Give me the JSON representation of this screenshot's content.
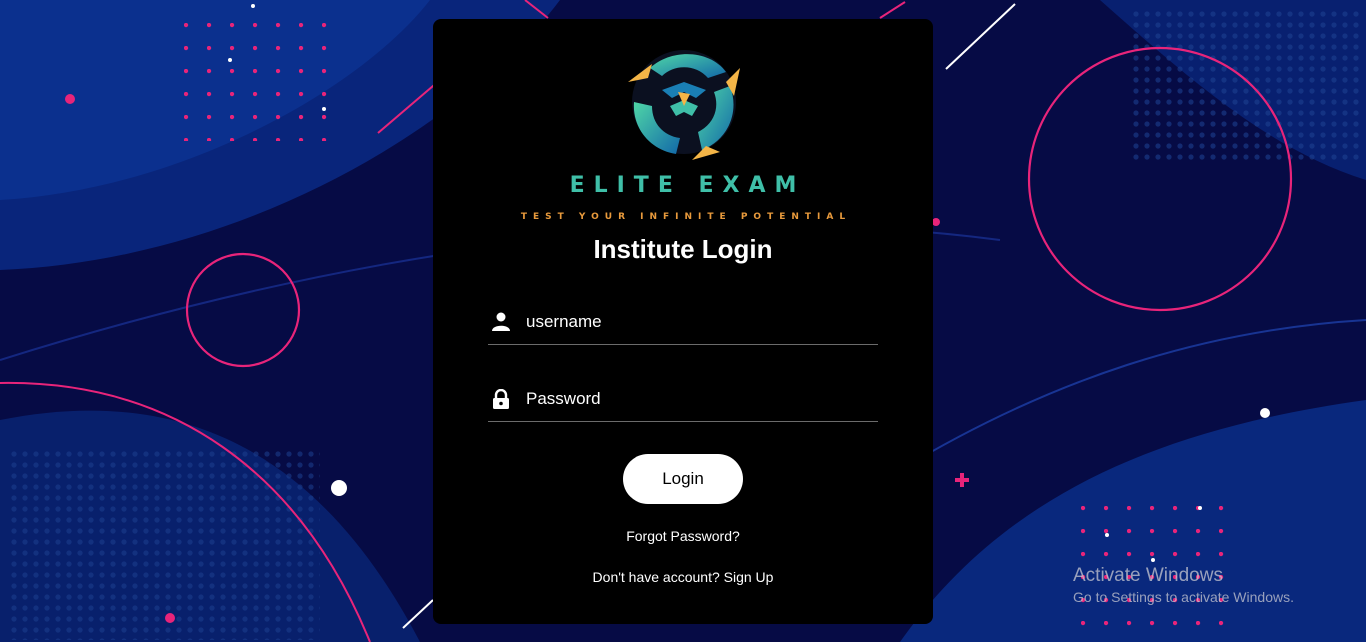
{
  "brand": {
    "name": "ELITE EXAM",
    "tagline": "TEST YOUR INFINITE POTENTIAL",
    "logo_colors": [
      "#3fbfa8",
      "#1a7fb5",
      "#e89a3c"
    ]
  },
  "form": {
    "title": "Institute Login",
    "username": {
      "placeholder": "username",
      "value": "",
      "icon": "person-icon"
    },
    "password": {
      "placeholder": "Password",
      "value": "",
      "icon": "lock-icon"
    },
    "login_label": "Login",
    "forgot_label": "Forgot Password?",
    "signup_label": "Don't have account? Sign Up"
  },
  "watermark": {
    "line1": "Activate Windows",
    "line2": "Go to Settings to activate Windows."
  },
  "colors": {
    "background": "#05093a",
    "accent_pink": "#e8247a",
    "card": "#000000"
  }
}
